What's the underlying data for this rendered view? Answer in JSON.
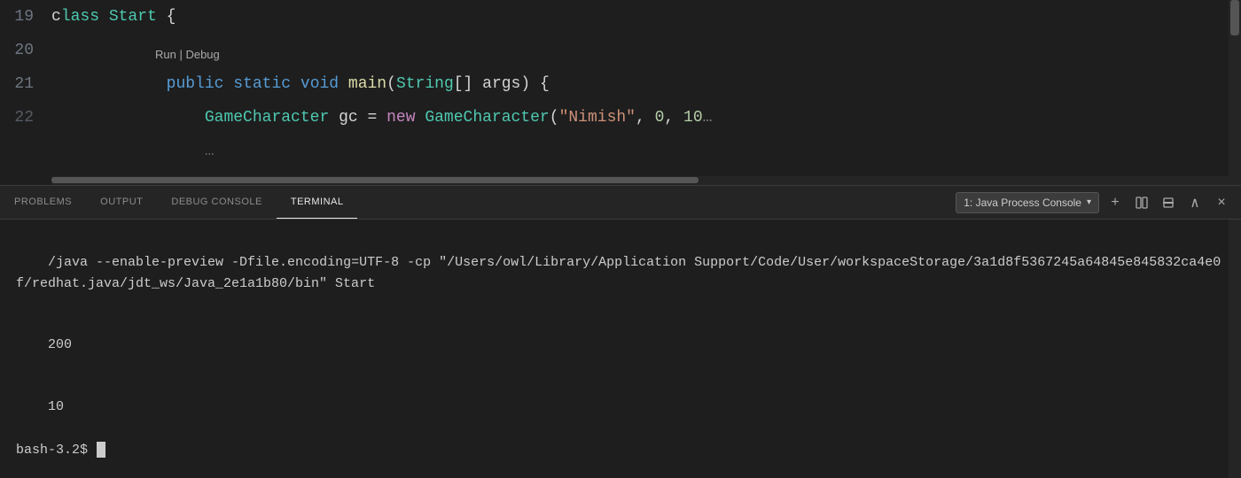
{
  "editor": {
    "lines": [
      {
        "number": "19",
        "tokens": [
          {
            "text": "c",
            "class": "kw-white"
          },
          {
            "text": "lass ",
            "class": "kw-class"
          },
          {
            "text": "Start",
            "class": "kw-class"
          },
          {
            "text": " {",
            "class": "kw-white"
          }
        ]
      },
      {
        "number": "20",
        "tokens": [
          {
            "text": "    ",
            "class": "kw-white"
          },
          {
            "text": "public ",
            "class": "kw-blue"
          },
          {
            "text": "static ",
            "class": "kw-blue"
          },
          {
            "text": "void ",
            "class": "kw-blue"
          },
          {
            "text": "main",
            "class": "kw-yellow"
          },
          {
            "text": "(",
            "class": "kw-white"
          },
          {
            "text": "String",
            "class": "kw-teal"
          },
          {
            "text": "[] ",
            "class": "kw-white"
          },
          {
            "text": "args",
            "class": "kw-white"
          },
          {
            "text": ") {",
            "class": "kw-white"
          }
        ]
      },
      {
        "number": "21",
        "tokens": [
          {
            "text": "        ",
            "class": "kw-white"
          },
          {
            "text": "GameCharacter",
            "class": "kw-teal"
          },
          {
            "text": " gc = ",
            "class": "kw-white"
          },
          {
            "text": "new ",
            "class": "kw-purple"
          },
          {
            "text": "GameCharacter",
            "class": "kw-teal"
          },
          {
            "text": "(",
            "class": "kw-white"
          },
          {
            "text": "\"Nimish\"",
            "class": "kw-orange"
          },
          {
            "text": ", ",
            "class": "kw-white"
          },
          {
            "text": "0",
            "class": "kw-lime"
          },
          {
            "text": ", ",
            "class": "kw-white"
          },
          {
            "text": "10",
            "class": "kw-lime"
          },
          {
            "text": "…",
            "class": "kw-gray"
          }
        ]
      },
      {
        "number": "22",
        "tokens": [
          {
            "text": "        ",
            "class": "kw-white"
          },
          {
            "text": "…",
            "class": "kw-gray"
          }
        ]
      }
    ],
    "run_debug_label": "Run | Debug"
  },
  "panel": {
    "tabs": [
      {
        "label": "PROBLEMS",
        "active": false
      },
      {
        "label": "OUTPUT",
        "active": false
      },
      {
        "label": "DEBUG CONSOLE",
        "active": false
      },
      {
        "label": "TERMINAL",
        "active": true
      }
    ],
    "console_dropdown": "1: Java Process Console",
    "icons": [
      "+",
      "⬜",
      "🗑",
      "∧",
      "×"
    ]
  },
  "terminal": {
    "command_line": "/java --enable-preview -Dfile.encoding=UTF-8 -cp \"/Users/owl/Library/Application Support/Code/User/workspaceStorage/3a1d8f5367245a64845e845832ca4e0f/redhat.java/jdt_ws/Java_2e1a1b80/bin\" Start",
    "output_line1": "200",
    "output_line2": "10",
    "prompt": "bash-3.2$ "
  }
}
